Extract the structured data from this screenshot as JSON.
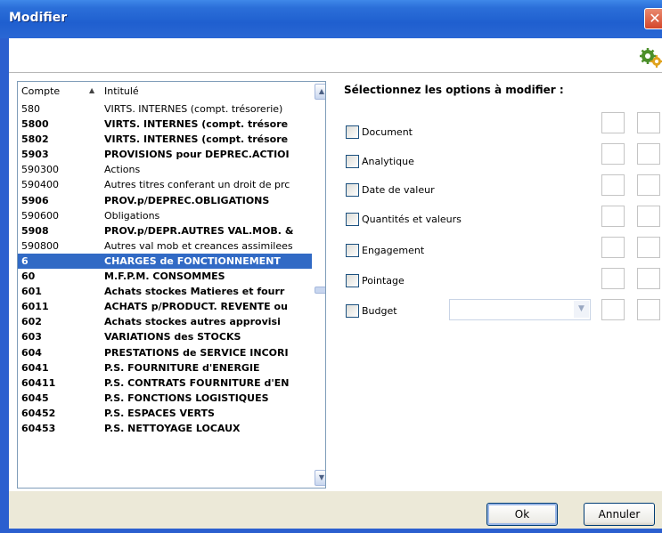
{
  "window": {
    "title": "Modifier",
    "close": "✕"
  },
  "list": {
    "header": {
      "compte": "Compte",
      "intitule": "Intitulé"
    },
    "rows": [
      {
        "compte": "580",
        "intitule": "VIRTS. INTERNES (compt. trésorerie)",
        "bold": false
      },
      {
        "compte": "5800",
        "intitule": "VIRTS. INTERNES (compt. trésore",
        "bold": true
      },
      {
        "compte": "5802",
        "intitule": "VIRTS. INTERNES (compt. trésore",
        "bold": true
      },
      {
        "compte": "5903",
        "intitule": "PROVISIONS pour DEPREC.ACTIOI",
        "bold": true
      },
      {
        "compte": "590300",
        "intitule": "Actions",
        "bold": false
      },
      {
        "compte": "590400",
        "intitule": "Autres titres conferant un droit de prc",
        "bold": false
      },
      {
        "compte": "5906",
        "intitule": "PROV.p/DEPREC.OBLIGATIONS",
        "bold": true
      },
      {
        "compte": "590600",
        "intitule": "Obligations",
        "bold": false
      },
      {
        "compte": "5908",
        "intitule": "PROV.p/DEPR.AUTRES VAL.MOB. &",
        "bold": true
      },
      {
        "compte": "590800",
        "intitule": "Autres val mob et creances assimilees",
        "bold": false
      },
      {
        "compte": "6",
        "intitule": "CHARGES de FONCTIONNEMENT",
        "bold": true,
        "selected": true
      },
      {
        "compte": "60",
        "intitule": "M.F.P.M. CONSOMMES",
        "bold": true
      },
      {
        "compte": "601",
        "intitule": "Achats stockes Matieres et fourr",
        "bold": true
      },
      {
        "compte": "6011",
        "intitule": "ACHATS p/PRODUCT. REVENTE ou",
        "bold": true
      },
      {
        "compte": "602",
        "intitule": "Achats stockes autres approvisi",
        "bold": true
      },
      {
        "compte": "603",
        "intitule": "VARIATIONS des STOCKS",
        "bold": true
      },
      {
        "compte": "604",
        "intitule": "PRESTATIONS de SERVICE INCORI",
        "bold": true
      },
      {
        "compte": "6041",
        "intitule": "P.S. FOURNITURE d'ENERGIE",
        "bold": true
      },
      {
        "compte": "60411",
        "intitule": "P.S. CONTRATS FOURNITURE d'EN",
        "bold": true
      },
      {
        "compte": "6045",
        "intitule": "P.S. FONCTIONS LOGISTIQUES",
        "bold": true
      },
      {
        "compte": "60452",
        "intitule": "P.S. ESPACES VERTS",
        "bold": true
      },
      {
        "compte": "60453",
        "intitule": "P.S. NETTOYAGE LOCAUX",
        "bold": true
      }
    ]
  },
  "options": {
    "title": "Sélectionnez les options à modifier :",
    "items": [
      {
        "label": "Document"
      },
      {
        "label": "Analytique"
      },
      {
        "label": "Date de valeur"
      },
      {
        "label": "Quantités et valeurs"
      },
      {
        "label": "Engagement"
      },
      {
        "label": "Pointage"
      },
      {
        "label": "Budget"
      }
    ],
    "budget_combo": {
      "value": ""
    }
  },
  "buttons": {
    "ok": "Ok",
    "cancel": "Annuler"
  },
  "colors": {
    "selection": "#316ac5",
    "titlebar": "#2b6fd9"
  }
}
